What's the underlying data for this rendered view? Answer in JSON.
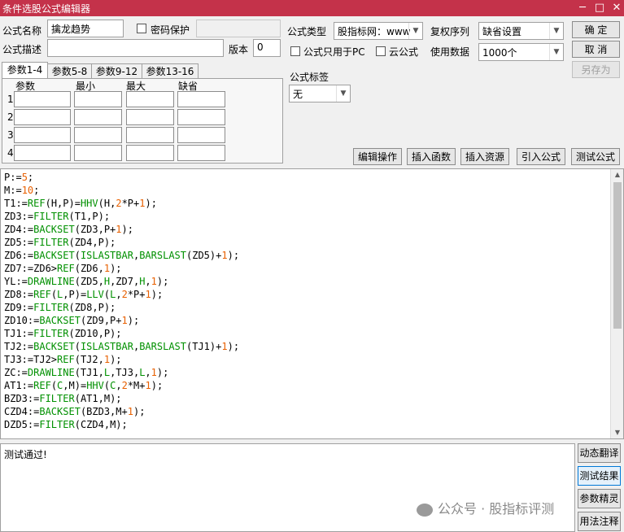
{
  "window": {
    "title": "条件选股公式编辑器",
    "minimize": "─",
    "maximize": "□",
    "close": "✕"
  },
  "form": {
    "name_label": "公式名称",
    "name_value": "擒龙趋势",
    "password_label": "密码保护",
    "desc_label": "公式描述",
    "desc_value": "",
    "version_label": "版本",
    "version_value": "0",
    "type_label": "公式类型",
    "type_value": "股指标网：www",
    "restore_label": "复权序列",
    "restore_value": "缺省设置",
    "pc_only_label": "公式只用于PC",
    "cloud_label": "云公式",
    "data_label": "使用数据",
    "data_value": "1000个",
    "tag_label": "公式标签",
    "tag_value": "无"
  },
  "buttons": {
    "ok": "确  定",
    "cancel": "取  消",
    "save_as": "另存为",
    "edit_ops": "编辑操作",
    "insert_func": "插入函数",
    "insert_res": "插入资源",
    "import": "引入公式",
    "test": "测试公式"
  },
  "tabs": [
    "参数1-4",
    "参数5-8",
    "参数9-12",
    "参数13-16"
  ],
  "param_headers": [
    "参数",
    "最小",
    "最大",
    "缺省"
  ],
  "param_rows": [
    "1",
    "2",
    "3",
    "4"
  ],
  "code_lines": [
    [
      [
        "P:=",
        ""
      ],
      [
        "5",
        "n"
      ],
      [
        ";",
        ""
      ]
    ],
    [
      [
        "M:=",
        ""
      ],
      [
        "10",
        "n"
      ],
      [
        ";",
        ""
      ]
    ],
    [
      [
        "T1:=",
        ""
      ],
      [
        "REF",
        "k"
      ],
      [
        "(H,P)=",
        ""
      ],
      [
        "HHV",
        "k"
      ],
      [
        "(H,",
        ""
      ],
      [
        "2",
        "n"
      ],
      [
        "*P+",
        ""
      ],
      [
        "1",
        "n"
      ],
      [
        ");",
        ""
      ]
    ],
    [
      [
        "ZD3:=",
        ""
      ],
      [
        "FILTER",
        "k"
      ],
      [
        "(T1,P);",
        ""
      ]
    ],
    [
      [
        "ZD4:=",
        ""
      ],
      [
        "BACKSET",
        "k"
      ],
      [
        "(ZD3,P+",
        ""
      ],
      [
        "1",
        "n"
      ],
      [
        ");",
        ""
      ]
    ],
    [
      [
        "ZD5:=",
        ""
      ],
      [
        "FILTER",
        "k"
      ],
      [
        "(ZD4,P);",
        ""
      ]
    ],
    [
      [
        "ZD6:=",
        ""
      ],
      [
        "BACKSET",
        "k"
      ],
      [
        "(",
        ""
      ],
      [
        "ISLASTBAR",
        "k"
      ],
      [
        ",",
        ""
      ],
      [
        "BARSLAST",
        "k"
      ],
      [
        "(ZD5)+",
        ""
      ],
      [
        "1",
        "n"
      ],
      [
        ");",
        ""
      ]
    ],
    [
      [
        "ZD7:=ZD6>",
        ""
      ],
      [
        "REF",
        "k"
      ],
      [
        "(ZD6,",
        ""
      ],
      [
        "1",
        "n"
      ],
      [
        ");",
        ""
      ]
    ],
    [
      [
        "YL:=",
        ""
      ],
      [
        "DRAWLINE",
        "k"
      ],
      [
        "(ZD5,",
        ""
      ],
      [
        "H",
        "k"
      ],
      [
        ",ZD7,",
        ""
      ],
      [
        "H",
        "k"
      ],
      [
        ",",
        ""
      ],
      [
        "1",
        "n"
      ],
      [
        ");",
        ""
      ]
    ],
    [
      [
        "ZD8:=",
        ""
      ],
      [
        "REF",
        "k"
      ],
      [
        "(",
        ""
      ],
      [
        "L",
        "k"
      ],
      [
        ",P)=",
        ""
      ],
      [
        "LLV",
        "k"
      ],
      [
        "(",
        ""
      ],
      [
        "L",
        "k"
      ],
      [
        ",",
        ""
      ],
      [
        "2",
        "n"
      ],
      [
        "*P+",
        ""
      ],
      [
        "1",
        "n"
      ],
      [
        ");",
        ""
      ]
    ],
    [
      [
        "ZD9:=",
        ""
      ],
      [
        "FILTER",
        "k"
      ],
      [
        "(ZD8,P);",
        ""
      ]
    ],
    [
      [
        "ZD10:=",
        ""
      ],
      [
        "BACKSET",
        "k"
      ],
      [
        "(ZD9,P+",
        ""
      ],
      [
        "1",
        "n"
      ],
      [
        ");",
        ""
      ]
    ],
    [
      [
        "TJ1:=",
        ""
      ],
      [
        "FILTER",
        "k"
      ],
      [
        "(ZD10,P);",
        ""
      ]
    ],
    [
      [
        "TJ2:=",
        ""
      ],
      [
        "BACKSET",
        "k"
      ],
      [
        "(",
        ""
      ],
      [
        "ISLASTBAR",
        "k"
      ],
      [
        ",",
        ""
      ],
      [
        "BARSLAST",
        "k"
      ],
      [
        "(TJ1)+",
        ""
      ],
      [
        "1",
        "n"
      ],
      [
        ");",
        ""
      ]
    ],
    [
      [
        "TJ3:=TJ2>",
        ""
      ],
      [
        "REF",
        "k"
      ],
      [
        "(TJ2,",
        ""
      ],
      [
        "1",
        "n"
      ],
      [
        ");",
        ""
      ]
    ],
    [
      [
        "ZC:=",
        ""
      ],
      [
        "DRAWLINE",
        "k"
      ],
      [
        "(TJ1,",
        ""
      ],
      [
        "L",
        "k"
      ],
      [
        ",TJ3,",
        ""
      ],
      [
        "L",
        "k"
      ],
      [
        ",",
        ""
      ],
      [
        "1",
        "n"
      ],
      [
        ");",
        ""
      ]
    ],
    [
      [
        "AT1:=",
        ""
      ],
      [
        "REF",
        "k"
      ],
      [
        "(",
        ""
      ],
      [
        "C",
        "k"
      ],
      [
        ",M)=",
        ""
      ],
      [
        "HHV",
        "k"
      ],
      [
        "(",
        ""
      ],
      [
        "C",
        "k"
      ],
      [
        ",",
        ""
      ],
      [
        "2",
        "n"
      ],
      [
        "*M+",
        ""
      ],
      [
        "1",
        "n"
      ],
      [
        ");",
        ""
      ]
    ],
    [
      [
        "BZD3:=",
        ""
      ],
      [
        "FILTER",
        "k"
      ],
      [
        "(AT1,M);",
        ""
      ]
    ],
    [
      [
        "CZD4:=",
        ""
      ],
      [
        "BACKSET",
        "k"
      ],
      [
        "(BZD3,M+",
        ""
      ],
      [
        "1",
        "n"
      ],
      [
        ");",
        ""
      ]
    ],
    [
      [
        "DZD5:=",
        ""
      ],
      [
        "FILTER",
        "k"
      ],
      [
        "(CZD4,M);",
        ""
      ]
    ]
  ],
  "result_text": "测试通过!",
  "side_buttons": [
    "动态翻译",
    "测试结果",
    "参数精灵",
    "用法注释"
  ],
  "watermark": "公众号 · 股指标评测"
}
